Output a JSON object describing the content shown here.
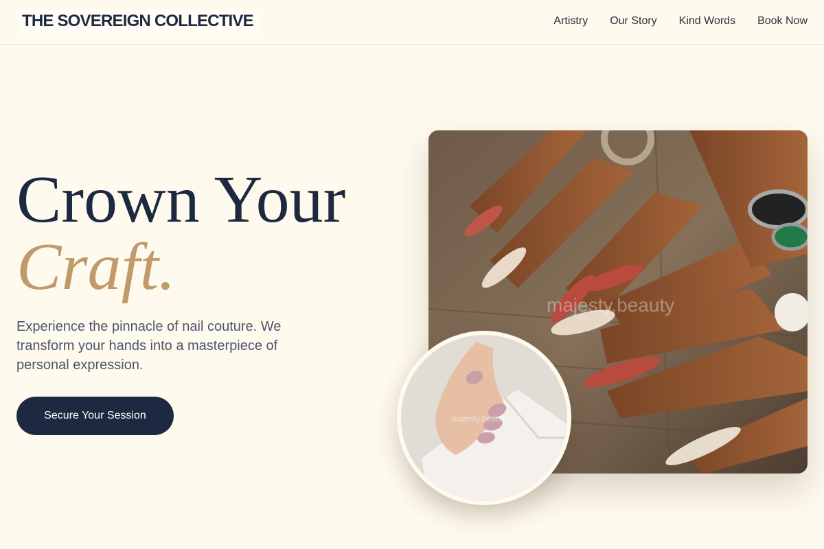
{
  "brand": {
    "name": "THE SOVEREIGN COLLECTIVE"
  },
  "nav": {
    "items": [
      {
        "label": "Artistry"
      },
      {
        "label": "Our Story"
      },
      {
        "label": "Kind Words"
      },
      {
        "label": "Book Now"
      }
    ]
  },
  "hero": {
    "title_line1": "Crown Your",
    "title_line2": "Craft.",
    "description": "Experience the pinnacle of nail couture. We transform your hands into a masterpiece of personal expression.",
    "cta_label": "Secure Your Session"
  },
  "images": {
    "main_photo": {
      "watermark": "majesty.beauty"
    },
    "inset_photo": {
      "watermark": "majesty.beauty"
    }
  },
  "colors": {
    "background": "#fffaee",
    "navy": "#1c2940",
    "gold_accent": "#c19a6b",
    "body_text": "#4a566b"
  }
}
